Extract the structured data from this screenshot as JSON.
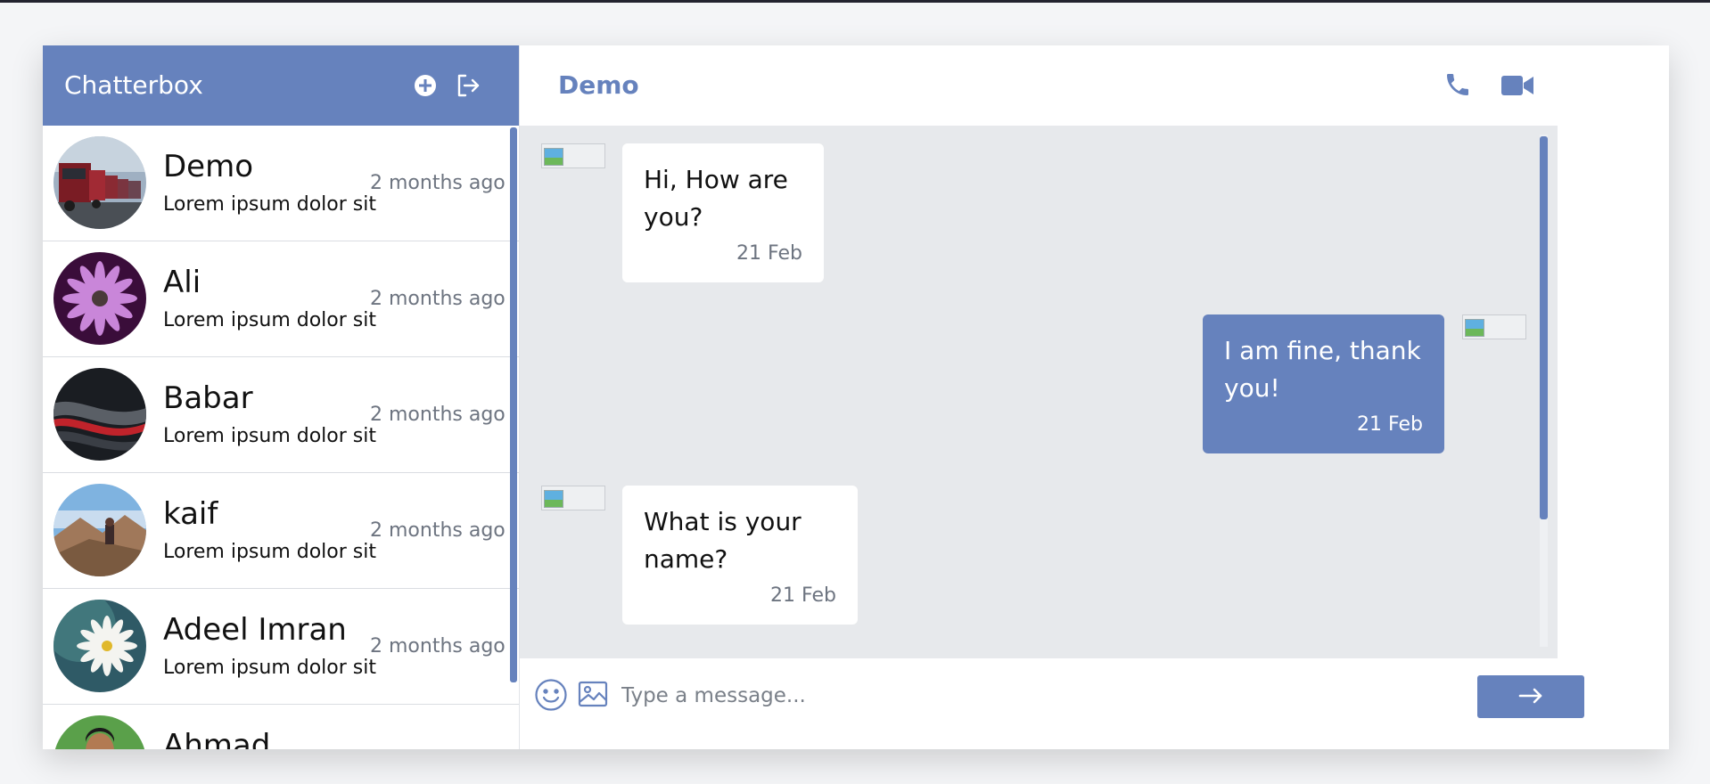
{
  "app": {
    "title": "Chatterbox"
  },
  "icons": {
    "new_chat": "plus-circle-icon",
    "logout": "logout-icon",
    "call": "phone-icon",
    "video": "video-camera-icon",
    "emoji": "smiley-icon",
    "image": "image-icon",
    "send": "arrow-right-icon"
  },
  "contacts": [
    {
      "name": "Demo",
      "preview": "Lorem ipsum dolor sit",
      "time": "2 months ago"
    },
    {
      "name": "Ali",
      "preview": "Lorem ipsum dolor sit",
      "time": "2 months ago"
    },
    {
      "name": "Babar",
      "preview": "Lorem ipsum dolor sit",
      "time": "2 months ago"
    },
    {
      "name": "kaif",
      "preview": "Lorem ipsum dolor sit",
      "time": "2 months ago"
    },
    {
      "name": "Adeel Imran",
      "preview": "Lorem ipsum dolor sit",
      "time": "2 months ago"
    },
    {
      "name": "Ahmad",
      "preview": "",
      "time": ""
    }
  ],
  "chat": {
    "title": "Demo",
    "messages": [
      {
        "direction": "in",
        "text": "Hi, How are you?",
        "time": "21 Feb"
      },
      {
        "direction": "out",
        "text": "I am fine, thank you!",
        "time": "21 Feb"
      },
      {
        "direction": "in",
        "text": "What is your name?",
        "time": "21 Feb"
      }
    ]
  },
  "composer": {
    "placeholder": "Type a message..."
  },
  "colors": {
    "accent": "#6682bd",
    "chat_bg": "#e7e9ec",
    "muted_text": "#6d7480"
  }
}
